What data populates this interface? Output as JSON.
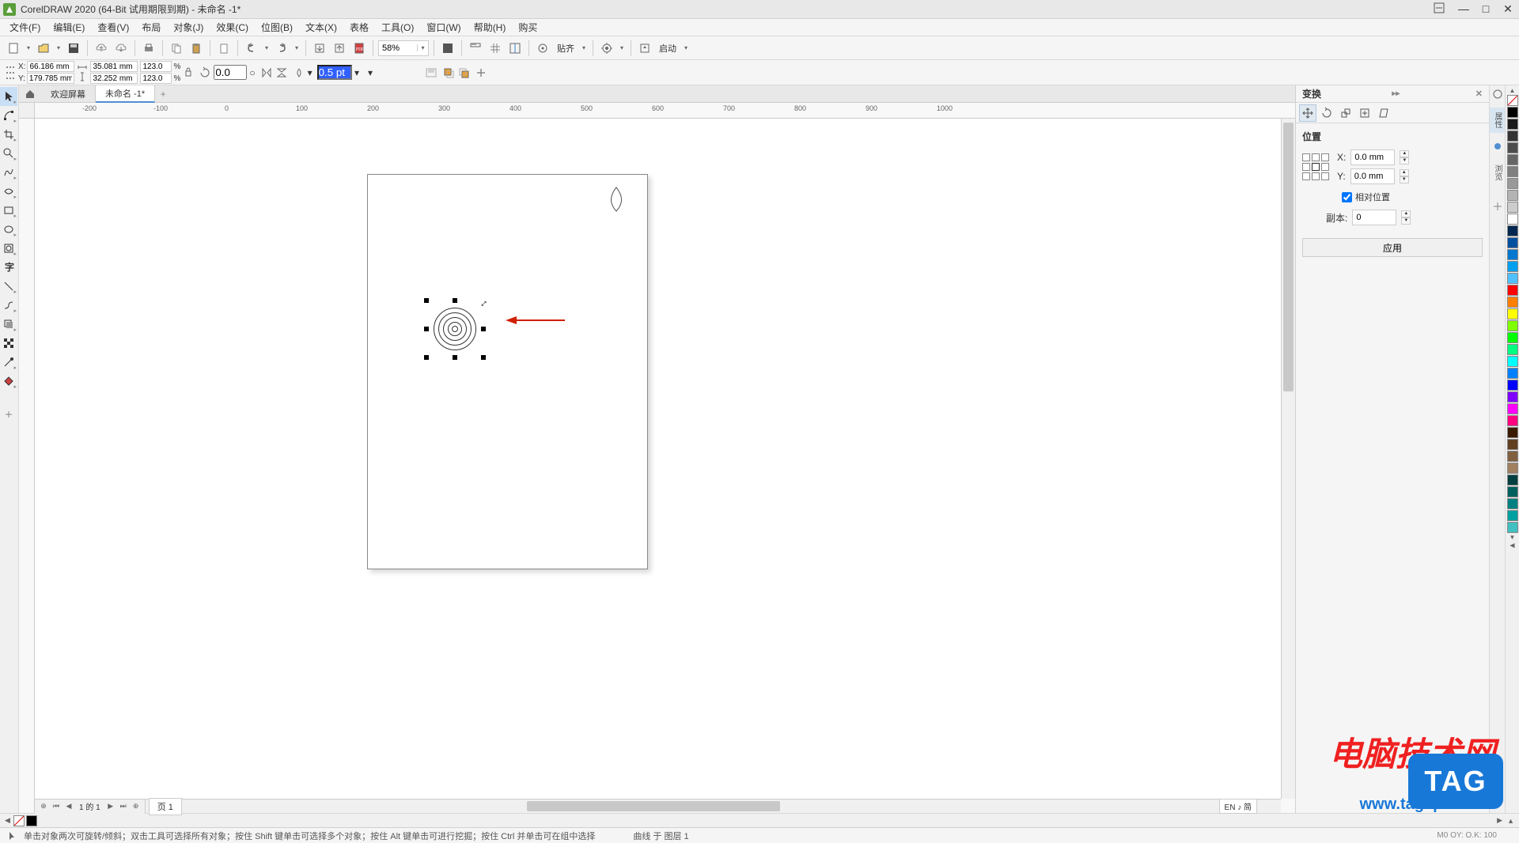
{
  "app": {
    "title": "CorelDRAW 2020 (64-Bit 试用期限到期) - 未命名 -1*"
  },
  "menu": [
    "文件(F)",
    "编辑(E)",
    "查看(V)",
    "布局",
    "对象(J)",
    "效果(C)",
    "位图(B)",
    "文本(X)",
    "表格",
    "工具(O)",
    "窗口(W)",
    "帮助(H)",
    "购买"
  ],
  "toolbar1": {
    "zoom": "58%",
    "align": "贴齐",
    "launch": "启动"
  },
  "propbar": {
    "x": "66.186 mm",
    "y": "179.785 mm",
    "w": "35.081 mm",
    "h": "32.252 mm",
    "sx": "123.0",
    "sy": "123.0",
    "sx_unit": "%",
    "sy_unit": "%",
    "rotate": "0.0",
    "deg": "○",
    "outline": "0.5 pt"
  },
  "docTabs": {
    "welcome": "欢迎屏幕",
    "doc1": "未命名 -1*"
  },
  "ruler_ticks": [
    "-200",
    "-100",
    "0",
    "100",
    "200",
    "300",
    "400",
    "500",
    "600",
    "700",
    "800",
    "900",
    "1000"
  ],
  "pageNav": {
    "counter": "1 的 1",
    "page1": "页 1"
  },
  "lang": "EN ♪ 简",
  "docker": {
    "title": "变换",
    "section": "位置",
    "xlabel": "X:",
    "ylabel": "Y:",
    "xval": "0.0 mm",
    "yval": "0.0 mm",
    "relative": "相对位置",
    "copies_label": "副本:",
    "copies": "0",
    "apply": "应用"
  },
  "sideTabs": [
    "属性",
    "浏览"
  ],
  "palette_colors": [
    "#ffffff",
    "#000000",
    "#1a1a1a",
    "#333333",
    "#4d4d4d",
    "#666666",
    "#808080",
    "#999999",
    "#b3b3b3",
    "#cccccc",
    "#800000",
    "#ff0000",
    "#ff8000",
    "#ffff00",
    "#80ff00",
    "#00ff00",
    "#00ff80",
    "#00ffff",
    "#0080ff",
    "#0000ff",
    "#8000ff",
    "#ff00ff",
    "#ff0080",
    "#400000",
    "#804000",
    "#808000",
    "#408000",
    "#008000",
    "#008040",
    "#008080",
    "#004080"
  ],
  "bottom_colors": [
    "#ffffff",
    "#000000"
  ],
  "status": {
    "hint": "单击对象两次可旋转/倾斜；双击工具可选择所有对象；按住 Shift 键单击可选择多个对象；按住 Alt 键单击可进行挖掘；按住 Ctrl 并单击可在组中选择",
    "layer": "曲线 于 图层 1",
    "coords": "M0   OY:   O.K:   100"
  },
  "watermark": {
    "red": "电脑技术网",
    "blue": "TAG",
    "url": "www.tagxp.com"
  }
}
